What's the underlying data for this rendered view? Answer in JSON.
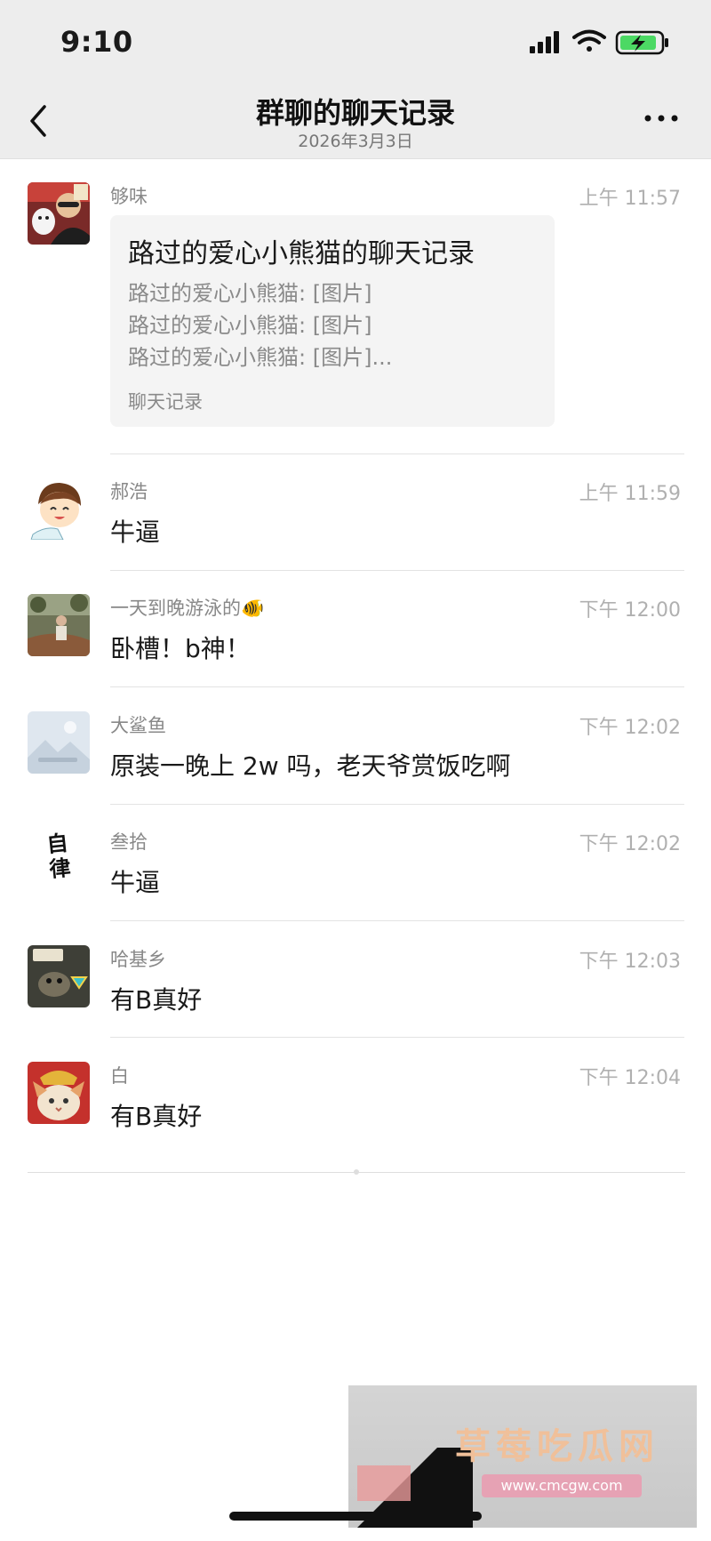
{
  "status_bar": {
    "time": "9:10"
  },
  "nav": {
    "title": "群聊的聊天记录",
    "subtitle": "2026年3月3日"
  },
  "messages": [
    {
      "sender": "够味",
      "time": "上午 11:57",
      "type": "chat_record",
      "card": {
        "title": "路过的爱心小熊猫的聊天记录",
        "lines": [
          "路过的爱心小熊猫: [图片]",
          "路过的爱心小熊猫: [图片]",
          "路过的爱心小熊猫: [图片]..."
        ],
        "footer": "聊天记录"
      }
    },
    {
      "sender": "郝浩",
      "time": "上午 11:59",
      "text": "牛逼"
    },
    {
      "sender": "一天到晚游泳的🐠",
      "time": "下午 12:00",
      "text": "卧槽！b神！"
    },
    {
      "sender": "大鲨鱼",
      "time": "下午 12:02",
      "text": "原装一晚上 2w 吗，老天爷赏饭吃啊"
    },
    {
      "sender": "叁拾",
      "time": "下午 12:02",
      "text": "牛逼",
      "avatar_text": "自律"
    },
    {
      "sender": "哈基乡",
      "time": "下午 12:03",
      "text": "有B真好"
    },
    {
      "sender": "白",
      "time": "下午 12:04",
      "text": "有B真好"
    }
  ],
  "watermark": {
    "title": "草莓吃瓜网",
    "url": "www.cmcgw.com"
  },
  "colors": {
    "header_bg": "#ededed",
    "card_bg": "#f4f4f4",
    "meta_gray": "#888888",
    "battery_green": "#4cd964"
  }
}
